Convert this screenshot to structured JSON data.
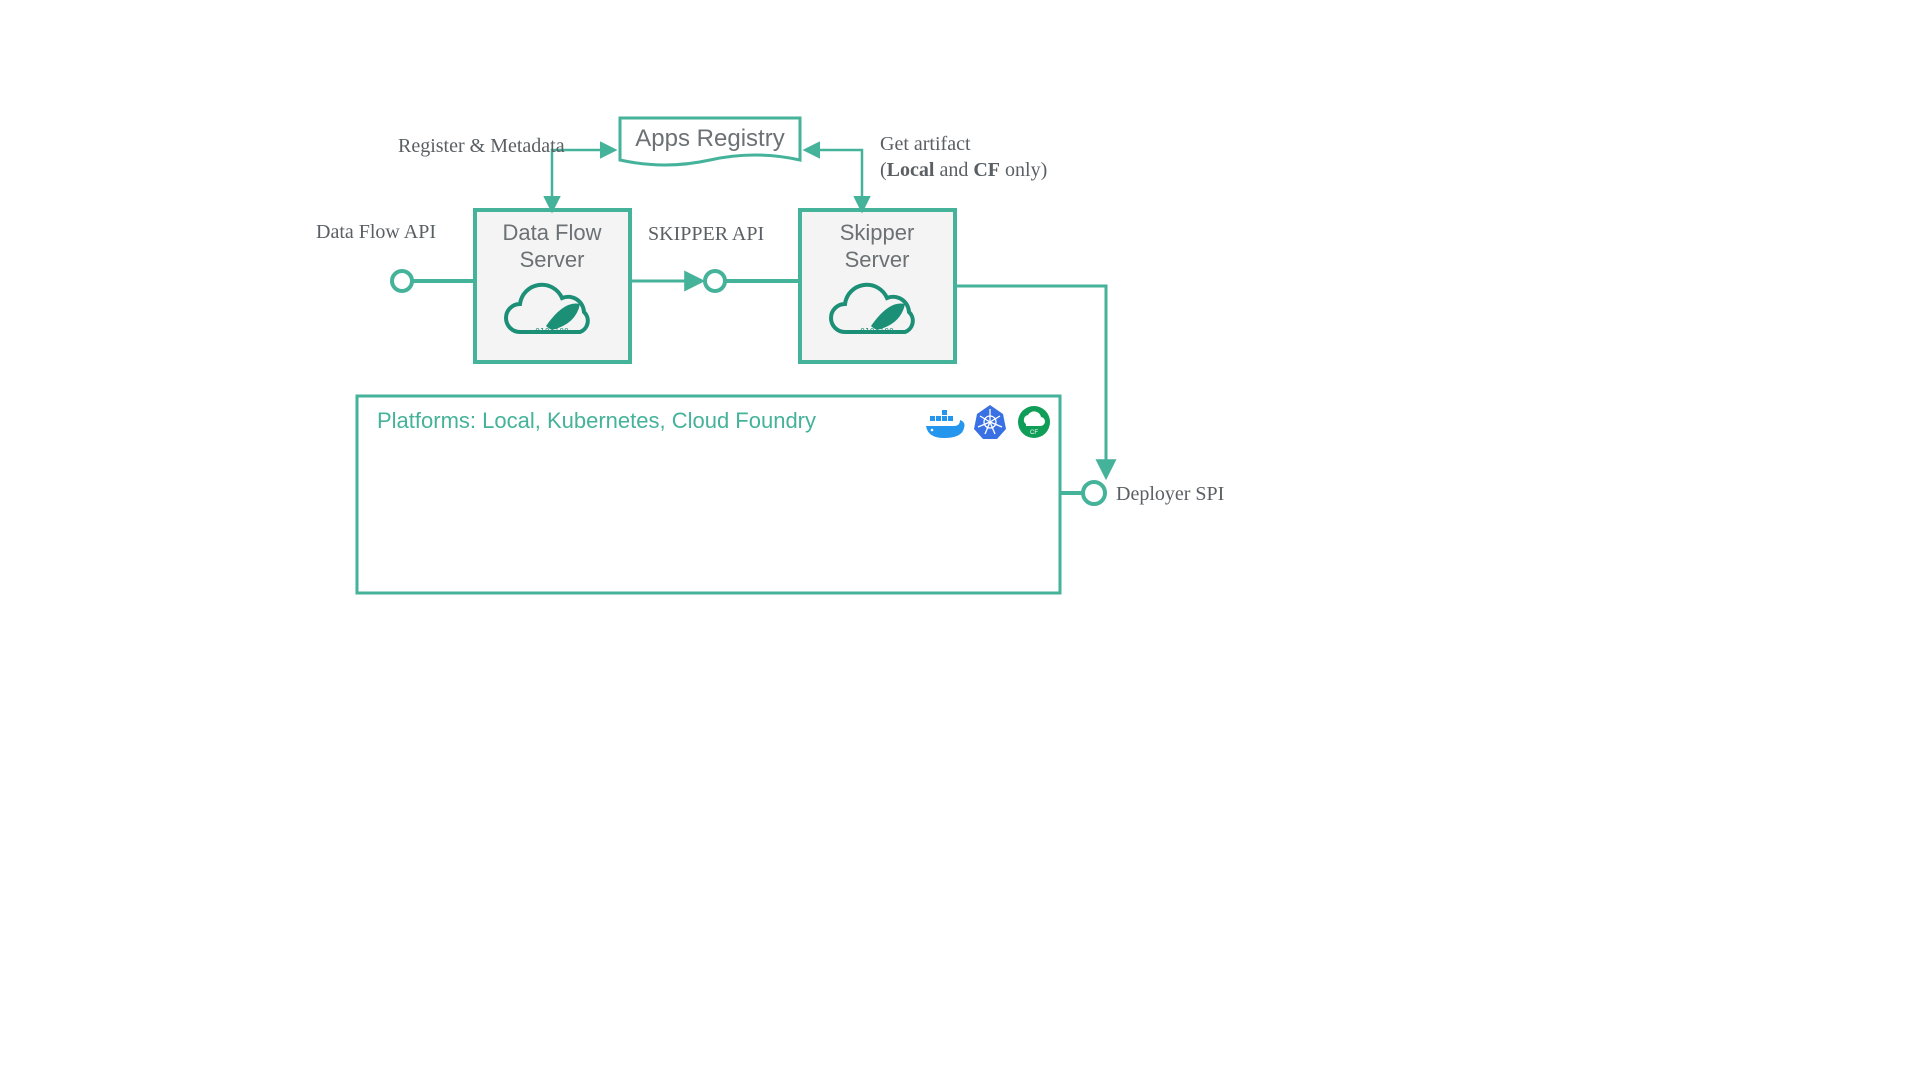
{
  "colors": {
    "accent": "#45b29a",
    "accent_dark": "#2f9e85",
    "box_fill": "#f4f4f4",
    "text_gray": "#6b7174",
    "docker_blue": "#2496ed",
    "k8s_blue": "#3970e4",
    "cf_green": "#0f9d58"
  },
  "labels": {
    "data_flow_api": "Data Flow API",
    "skipper_api": "SKIPPER API",
    "register_metadata": "Register & Metadata",
    "get_artifact_1": "Get artifact",
    "get_artifact_2a": "(",
    "get_artifact_2b": "Local",
    "get_artifact_2c": " and ",
    "get_artifact_2d": "CF",
    "get_artifact_2e": " only)",
    "deployer_spi": "Deployer SPI"
  },
  "boxes": {
    "apps_registry": "Apps Registry",
    "data_flow_server_1": "Data Flow",
    "data_flow_server_2": "Server",
    "skipper_server_1": "Skipper",
    "skipper_server_2": "Server",
    "platforms": "Platforms:  Local, Kubernetes, Cloud Foundry"
  },
  "icons": {
    "docker": "docker-icon",
    "kubernetes": "kubernetes-icon",
    "cloud_foundry": "cloud-foundry-icon"
  }
}
